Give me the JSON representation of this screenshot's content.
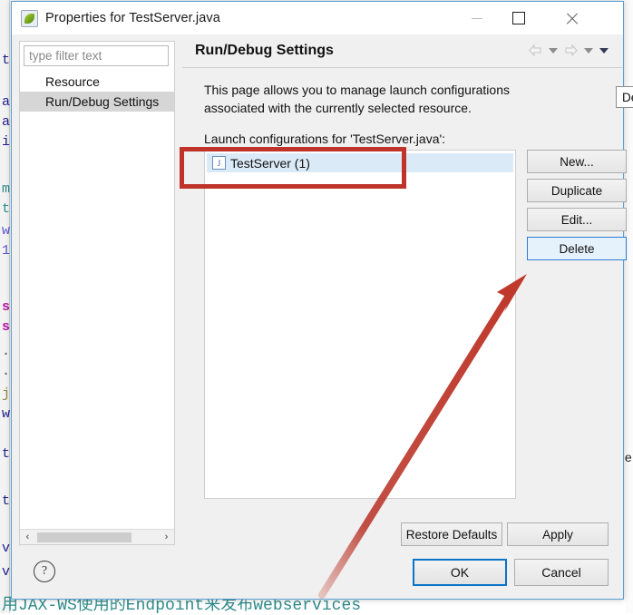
{
  "window": {
    "title": "Properties for TestServer.java",
    "icon": "eclipse-leaf-icon",
    "controls": {
      "minimize": "minimize-icon",
      "maximize": "maximize-icon",
      "close": "close-icon"
    }
  },
  "sidebar": {
    "filter_placeholder": "type filter text",
    "filter_value": "",
    "items": [
      {
        "label": "Resource",
        "selected": false
      },
      {
        "label": "Run/Debug Settings",
        "selected": true
      }
    ],
    "scrollbar": {
      "left_arrow": "‹",
      "right_arrow": "›"
    }
  },
  "page": {
    "title": "Run/Debug Settings",
    "nav_icons": [
      "back-arrow-icon",
      "chevron-down-icon",
      "forward-arrow-icon",
      "chevron-down-icon",
      "chevron-down-icon"
    ],
    "description_line1": "This page allows you to manage launch configurations",
    "description_line2": "associated with the currently selected resource.",
    "list_label": "Launch configurations for 'TestServer.java':",
    "list_items": [
      {
        "label": "TestServer (1)",
        "icon": "java-launch-config-icon",
        "selected": true
      }
    ],
    "side_buttons": [
      {
        "label": "New...",
        "state": "normal"
      },
      {
        "label": "Duplicate",
        "state": "normal"
      },
      {
        "label": "Edit...",
        "state": "normal"
      },
      {
        "label": "Delete",
        "state": "hover"
      }
    ],
    "tooltip": "Delete s",
    "footer_buttons": [
      {
        "label": "Restore Defaults",
        "state": "normal"
      },
      {
        "label": "Apply",
        "state": "normal"
      }
    ]
  },
  "dialog_footer": {
    "help": "?",
    "buttons": [
      {
        "label": "OK",
        "state": "focus"
      },
      {
        "label": "Cancel",
        "state": "normal"
      }
    ]
  },
  "background": {
    "bottom_text": "用JAX-WS使用的Endpoint来发布webservices",
    "left_glyphs": [
      "t",
      "a",
      "a",
      "i",
      "m",
      "t",
      "w",
      "1",
      "s",
      "s",
      "·",
      "·",
      "j",
      "w",
      "t",
      "t",
      "v",
      "v"
    ],
    "right_glyphs": [
      "e"
    ]
  },
  "annotations": {
    "highlight_rect_color": "#c0332a",
    "arrow_color": "#c0392b",
    "arrow_target": "delete-button"
  }
}
